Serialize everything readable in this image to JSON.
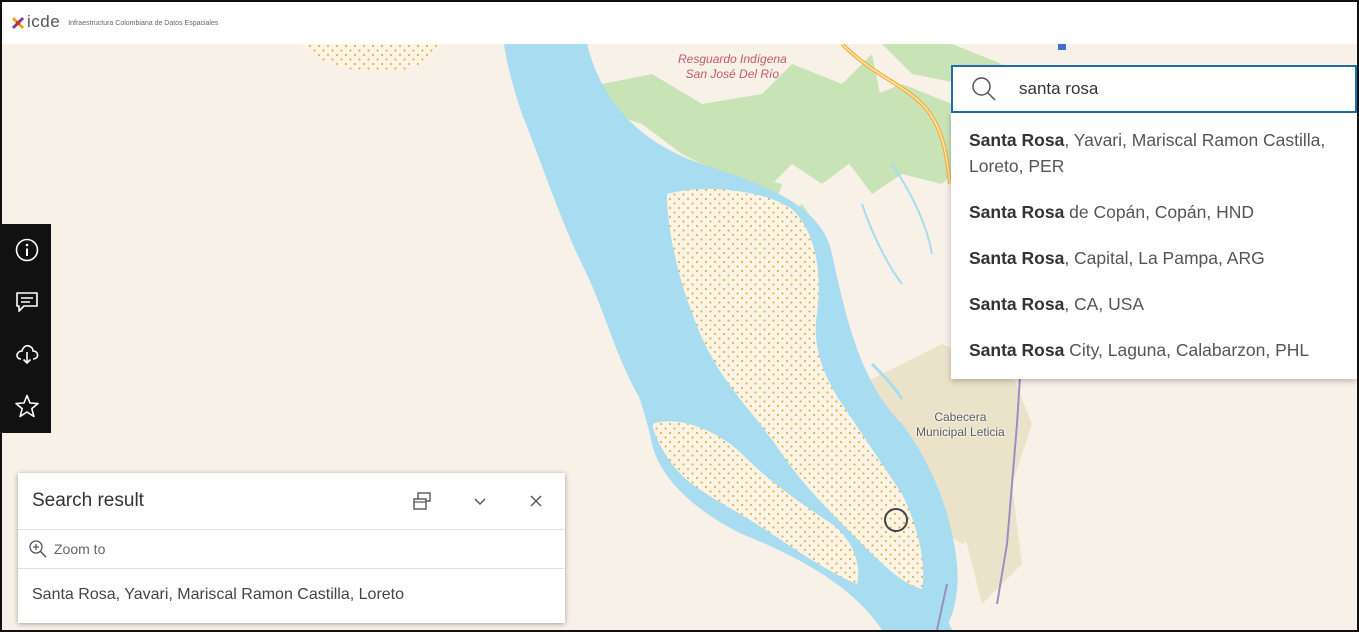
{
  "header": {
    "logo_text": "icde",
    "subtitle": "Infraestructura Colombiana de Datos Espaciales"
  },
  "map": {
    "labels": {
      "resguardo_line1": "Resguardo Indígena",
      "resguardo_line2": "San José Del Río",
      "cabecera_line1": "Cabecera",
      "cabecera_line2": "Municipal Leticia"
    },
    "colors": {
      "land": "#f7f1e8",
      "water": "#a8dcf0",
      "forest": "#c8e3b5",
      "sand": "#fbf4e4",
      "urban": "#ebe3c9"
    }
  },
  "toolbar": {
    "items": [
      {
        "name": "info-icon"
      },
      {
        "name": "comment-icon"
      },
      {
        "name": "cloud-download-icon"
      },
      {
        "name": "star-icon"
      }
    ]
  },
  "search": {
    "value": "santa rosa",
    "suggestions": [
      {
        "match": "Santa Rosa",
        "rest": ", Yavari, Mariscal Ramon Castilla, Loreto, PER"
      },
      {
        "match": "Santa Rosa",
        "rest": " de Copán, Copán, HND"
      },
      {
        "match": "Santa Rosa",
        "rest": ", Capital, La Pampa, ARG"
      },
      {
        "match": "Santa Rosa",
        "rest": ", CA, USA"
      },
      {
        "match": "Santa Rosa",
        "rest": " City, Laguna, Calabarzon, PHL"
      }
    ]
  },
  "result_panel": {
    "title": "Search result",
    "zoom_label": "Zoom to",
    "result_text": "Santa Rosa, Yavari, Mariscal Ramon Castilla, Loreto"
  }
}
